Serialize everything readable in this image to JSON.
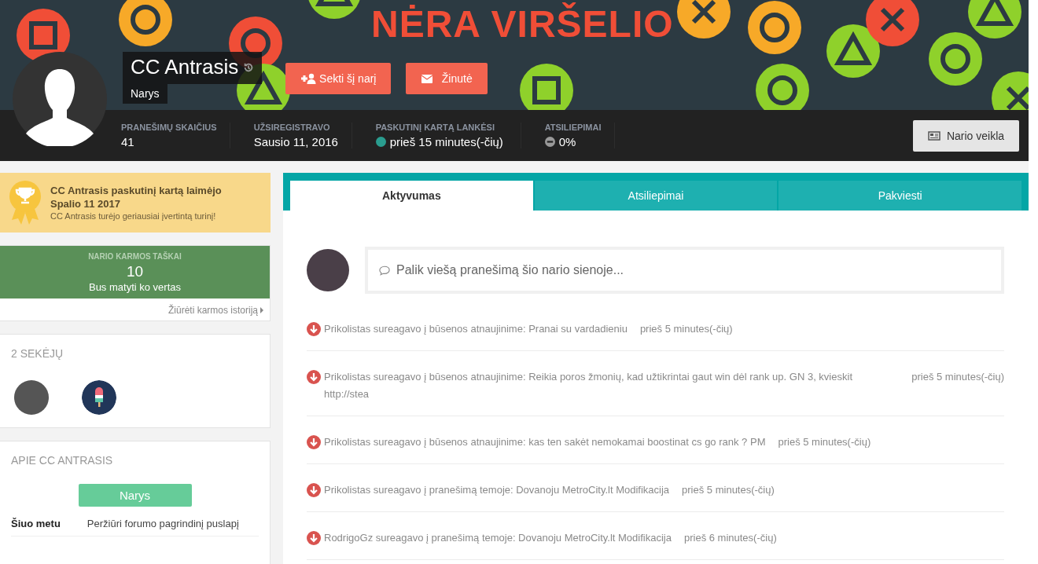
{
  "cover": {
    "text": "NĖRA VIRŠELIO"
  },
  "profile": {
    "name": "CC Antrasis",
    "group": "Narys",
    "buttons": [
      {
        "kind": "follow",
        "label": "Sekti šį narį"
      },
      {
        "kind": "message",
        "label": "Žinutė"
      }
    ]
  },
  "stats": [
    {
      "kind": "plain",
      "label": "PRANEŠIMŲ SKAIČIUS",
      "value": "41"
    },
    {
      "kind": "plain",
      "label": "UŽSIREGISTRAVO",
      "value": "Sausio 11, 2016"
    },
    {
      "kind": "online",
      "label": "PASKUTINĮ KARTĄ LANKĖSI",
      "value": "prieš 15 minutes(-čių)"
    },
    {
      "kind": "rating",
      "label": "ATSILIEPIMAI",
      "value": "0%"
    }
  ],
  "activity_button": "Nario veikla",
  "award": {
    "title": "CC Antrasis paskutinį kartą laimėjo",
    "date": "Spalio 11 2017",
    "note": "CC Antrasis turėjo geriausiai įvertintą turinį!"
  },
  "karma": {
    "label": "NARIO KARMOS TAŠKAI",
    "points": "10",
    "caption": "Bus matyti ko vertas",
    "link": "Žiūrėti karmos istoriją"
  },
  "followers": {
    "title": "2 SEKĖJŲ",
    "items": [
      {
        "kind": "photo"
      },
      {
        "kind": "popsicle"
      }
    ]
  },
  "about": {
    "title": "APIE CC ANTRASIS",
    "group": "Narys",
    "rows": [
      {
        "label": "Šiuo metu",
        "value": "Peržiūri forumo pagrindinį puslapį"
      }
    ]
  },
  "tabs": [
    {
      "label": "Aktyvumas",
      "selected": true
    },
    {
      "label": "Atsiliepimai",
      "selected": false
    },
    {
      "label": "Pakviesti",
      "selected": false
    }
  ],
  "status_field": {
    "placeholder": "Palik viešą pranešimą šio nario sienoje..."
  },
  "feed": [
    {
      "text": "Prikolistas sureagavo į būsenos atnaujinime: Pranai su vardadieniu",
      "time": "prieš 5 minutes(-čių)"
    },
    {
      "text": "Prikolistas sureagavo į būsenos atnaujinime: Reikia poros žmonių, kad užtikrintai gaut win dėl rank up. GN 3, kvieskit http://stea",
      "time": "prieš 5 minutes(-čių)"
    },
    {
      "text": "Prikolistas sureagavo į būsenos atnaujinime: kas ten sakėt nemokamai boostinat cs go rank ? PM",
      "time": "prieš 5 minutes(-čių)"
    },
    {
      "text": "Prikolistas sureagavo į pranešimą temoje: Dovanoju MetroCity.lt Modifikacija",
      "time": "prieš 5 minutes(-čių)"
    },
    {
      "text": "RodrigoGz sureagavo į pranešimą temoje: Dovanoju MetroCity.lt Modifikacija",
      "time": "prieš 6 minutes(-čių)"
    }
  ]
}
